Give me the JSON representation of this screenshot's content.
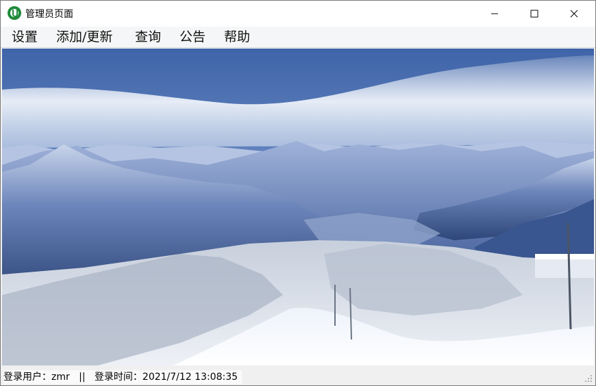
{
  "window": {
    "title": "管理员页面",
    "controls": {
      "minimize": "minimize-icon",
      "maximize": "maximize-icon",
      "close": "close-icon"
    }
  },
  "menubar": {
    "items": [
      "设置",
      "添加/更新",
      "查询",
      "公告",
      "帮助"
    ]
  },
  "content": {
    "image_subject": "snowy-mountain-ski-slope",
    "colors": {
      "sky": "#4c6fb0",
      "cloud": "#e8eef7",
      "mountain": "#3f5f9c",
      "snow": "#f4f7fb",
      "forest": "#d5dbe6"
    }
  },
  "statusbar": {
    "user_label": "登录用户：",
    "user_value": "zmr",
    "separator": "||",
    "time_label": "登录时间：",
    "time_value": "2021/7/12 13:08:35"
  }
}
